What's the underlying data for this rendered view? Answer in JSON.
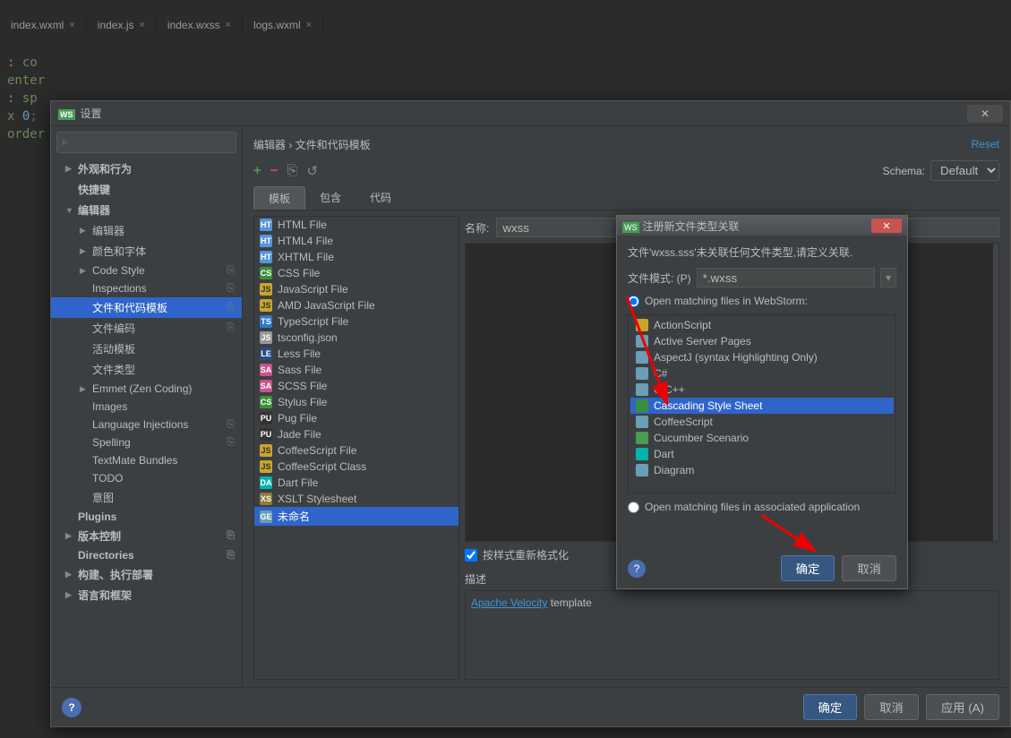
{
  "ide_tabs": [
    {
      "label": "index.wxml",
      "ico": "html"
    },
    {
      "label": "index.js",
      "ico": "js"
    },
    {
      "label": "index.wxss",
      "ico": "css"
    },
    {
      "label": "logs.wxml",
      "ico": "html"
    }
  ],
  "code_lines": [
    ": co",
    "enter",
    ": sp",
    "x 0;",
    "order"
  ],
  "settings": {
    "title": "设置",
    "breadcrumb": "编辑器 › 文件和代码模板",
    "reset": "Reset",
    "schema_label": "Schema:",
    "schema_value": "Default",
    "tabs": [
      "模板",
      "包含",
      "代码"
    ],
    "search_placeholder": "",
    "tree": [
      {
        "label": "外观和行为",
        "lvl": 1,
        "arrow": "▶"
      },
      {
        "label": "快捷键",
        "lvl": 1,
        "arrow": ""
      },
      {
        "label": "编辑器",
        "lvl": 1,
        "arrow": "▼"
      },
      {
        "label": "编辑器",
        "lvl": 2,
        "arrow": "▶"
      },
      {
        "label": "颜色和字体",
        "lvl": 2,
        "arrow": "▶"
      },
      {
        "label": "Code Style",
        "lvl": 2,
        "arrow": "▶",
        "badge": "⎘"
      },
      {
        "label": "Inspections",
        "lvl": 2,
        "arrow": "",
        "badge": "⎘"
      },
      {
        "label": "文件和代码模板",
        "lvl": 2,
        "arrow": "",
        "sel": true,
        "badge": "⎘"
      },
      {
        "label": "文件编码",
        "lvl": 2,
        "arrow": "",
        "badge": "⎘"
      },
      {
        "label": "活动模板",
        "lvl": 2,
        "arrow": ""
      },
      {
        "label": "文件类型",
        "lvl": 2,
        "arrow": ""
      },
      {
        "label": "Emmet (Zen Coding)",
        "lvl": 2,
        "arrow": "▶"
      },
      {
        "label": "Images",
        "lvl": 2,
        "arrow": ""
      },
      {
        "label": "Language Injections",
        "lvl": 2,
        "arrow": "",
        "badge": "⎘"
      },
      {
        "label": "Spelling",
        "lvl": 2,
        "arrow": "",
        "badge": "⎘"
      },
      {
        "label": "TextMate Bundles",
        "lvl": 2,
        "arrow": ""
      },
      {
        "label": "TODO",
        "lvl": 2,
        "arrow": ""
      },
      {
        "label": "意图",
        "lvl": 2,
        "arrow": ""
      },
      {
        "label": "Plugins",
        "lvl": 1,
        "arrow": ""
      },
      {
        "label": "版本控制",
        "lvl": 1,
        "arrow": "▶",
        "badge": "⎘"
      },
      {
        "label": "Directories",
        "lvl": 1,
        "arrow": "",
        "badge": "⎘"
      },
      {
        "label": "构建、执行部署",
        "lvl": 1,
        "arrow": "▶"
      },
      {
        "label": "语言和框架",
        "lvl": 1,
        "arrow": "▶"
      }
    ],
    "files": [
      {
        "label": "HTML File",
        "ico": "html"
      },
      {
        "label": "HTML4 File",
        "ico": "html"
      },
      {
        "label": "XHTML File",
        "ico": "html"
      },
      {
        "label": "CSS File",
        "ico": "css"
      },
      {
        "label": "JavaScript File",
        "ico": "js"
      },
      {
        "label": "AMD JavaScript File",
        "ico": "js"
      },
      {
        "label": "TypeScript File",
        "ico": "ts"
      },
      {
        "label": "tsconfig.json",
        "ico": "json"
      },
      {
        "label": "Less File",
        "ico": "less"
      },
      {
        "label": "Sass File",
        "ico": "sass"
      },
      {
        "label": "SCSS File",
        "ico": "sass"
      },
      {
        "label": "Stylus File",
        "ico": "css"
      },
      {
        "label": "Pug File",
        "ico": "pug"
      },
      {
        "label": "Jade File",
        "ico": "pug"
      },
      {
        "label": "CoffeeScript File",
        "ico": "js"
      },
      {
        "label": "CoffeeScript Class",
        "ico": "js"
      },
      {
        "label": "Dart File",
        "ico": "dart"
      },
      {
        "label": "XSLT Stylesheet",
        "ico": "xsl"
      },
      {
        "label": "未命名",
        "ico": "gen",
        "sel": true
      }
    ],
    "name_label": "名称:",
    "name_value": "wxss",
    "reformat_label": "按样式重新格式化",
    "desc_label": "描述",
    "desc_link": "Apache Velocity",
    "desc_rest": " template",
    "buttons": {
      "ok": "确定",
      "cancel": "取消",
      "apply": "应用 (A)"
    }
  },
  "register": {
    "title": "注册新文件类型关联",
    "msg": "文件'wxss.sss'未关联任何文件类型,请定义关联.",
    "pattern_label": "文件模式: (P)",
    "pattern_value": "*.wxss",
    "radio1": "Open matching files in WebStorm:",
    "radio2": "Open matching files in associated application",
    "list": [
      {
        "label": "ActionScript",
        "ico": "#c9a62b"
      },
      {
        "label": "Active Server Pages",
        "ico": "#6a9fb5"
      },
      {
        "label": "AspectJ (syntax Highlighting Only)",
        "ico": "#6a9fb5"
      },
      {
        "label": "C#",
        "ico": "#6a9fb5"
      },
      {
        "label": "C/C++",
        "ico": "#6a9fb5"
      },
      {
        "label": "Cascading Style Sheet",
        "ico": "#3b8f3b",
        "sel": true
      },
      {
        "label": "CoffeeScript",
        "ico": "#6a9fb5"
      },
      {
        "label": "Cucumber Scenario",
        "ico": "#499c54"
      },
      {
        "label": "Dart",
        "ico": "#00b4ab"
      },
      {
        "label": "Diagram",
        "ico": "#6a9fb5"
      }
    ],
    "ok": "确定",
    "cancel": "取消"
  }
}
